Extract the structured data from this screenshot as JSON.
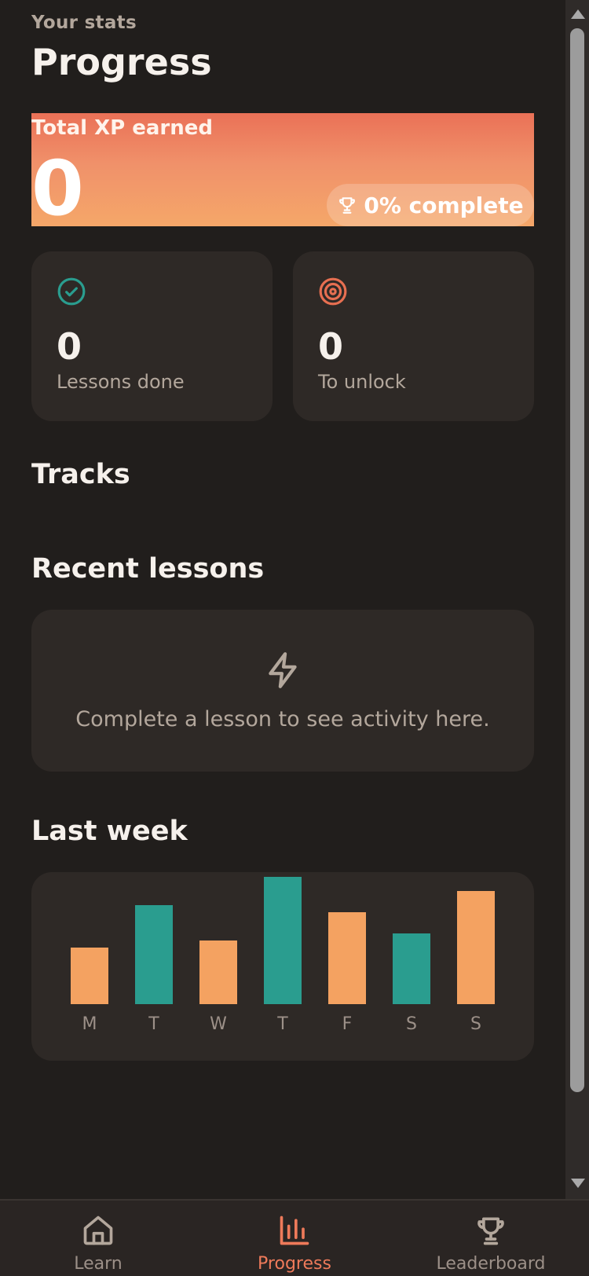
{
  "header": {
    "eyebrow": "Your stats",
    "title": "Progress"
  },
  "xp_card": {
    "label": "Total XP earned",
    "value": "0",
    "complete_label": "0% complete",
    "icon": "trophy-icon"
  },
  "stats": [
    {
      "value": "0",
      "label": "Lessons done",
      "icon": "check-circle-icon",
      "color": "#2a9d8f"
    },
    {
      "value": "0",
      "label": "To unlock",
      "icon": "target-icon",
      "color": "#e76f51"
    }
  ],
  "sections": {
    "tracks": "Tracks",
    "recent": "Recent lessons",
    "week": "Last week"
  },
  "recent_empty": {
    "icon": "lightning-icon",
    "message": "Complete a lesson to see activity here."
  },
  "chart_data": {
    "type": "bar",
    "categories": [
      "M",
      "T",
      "W",
      "T",
      "F",
      "S",
      "S"
    ],
    "values": [
      40,
      70,
      45,
      90,
      65,
      50,
      80
    ],
    "ylim": [
      0,
      100
    ],
    "colors": [
      "#f4a261",
      "#2a9d8f",
      "#f4a261",
      "#2a9d8f",
      "#f4a261",
      "#2a9d8f",
      "#f4a261"
    ]
  },
  "tabs": [
    {
      "label": "Learn",
      "icon": "home-icon",
      "active": false
    },
    {
      "label": "Progress",
      "icon": "bar-chart-icon",
      "active": true
    },
    {
      "label": "Leaderboard",
      "icon": "trophy-icon",
      "active": false
    }
  ],
  "colors": {
    "accent": "#ee7a5a",
    "teal": "#2a9d8f",
    "orange": "#f4a261",
    "background": "#211e1c",
    "card": "#2e2926"
  }
}
